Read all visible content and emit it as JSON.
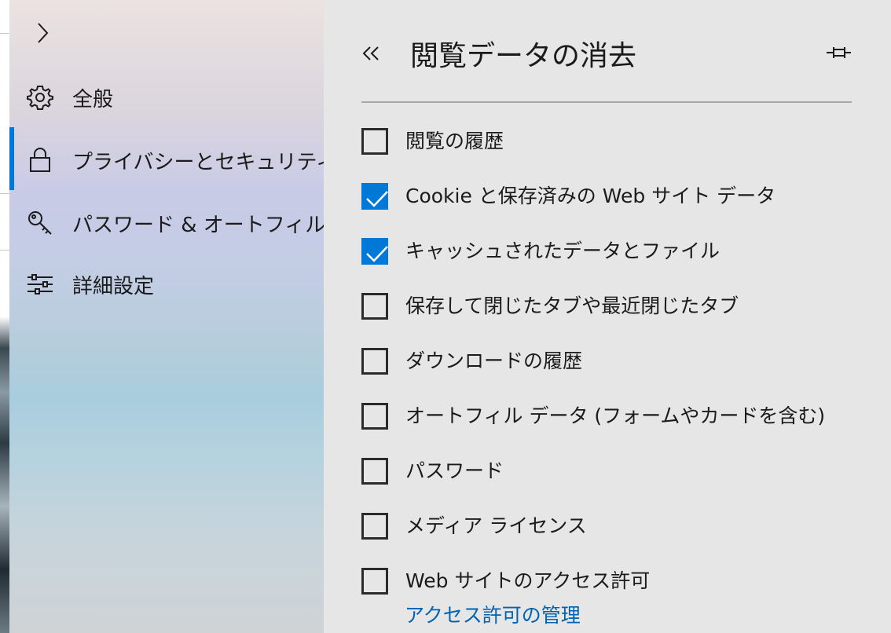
{
  "nav": {
    "items": [
      {
        "label": "全般",
        "icon": "gear-icon"
      },
      {
        "label": "プライバシーとセキュリティ",
        "icon": "lock-icon"
      },
      {
        "label": "パスワード & オートフィル",
        "icon": "key-icon"
      },
      {
        "label": "詳細設定",
        "icon": "sliders-icon"
      }
    ],
    "selected_index": 1
  },
  "panel": {
    "title": "閲覧データの消去",
    "back_icon": "double-chevron-left-icon",
    "pin_icon": "pin-icon",
    "checkboxes": [
      {
        "label": "閲覧の履歴",
        "checked": false
      },
      {
        "label": "Cookie と保存済みの Web サイト データ",
        "checked": true
      },
      {
        "label": "キャッシュされたデータとファイル",
        "checked": true
      },
      {
        "label": "保存して閉じたタブや最近閉じたタブ",
        "checked": false
      },
      {
        "label": "ダウンロードの履歴",
        "checked": false
      },
      {
        "label": "オートフィル データ (フォームやカードを含む)",
        "checked": false
      },
      {
        "label": "パスワード",
        "checked": false
      },
      {
        "label": "メディア ライセンス",
        "checked": false
      },
      {
        "label": "Web サイトのアクセス許可",
        "checked": false
      }
    ],
    "manage_link": "アクセス許可の管理"
  },
  "colors": {
    "accent": "#0078d7",
    "link": "#0063b1",
    "panel_bg": "#e6e6e6"
  }
}
